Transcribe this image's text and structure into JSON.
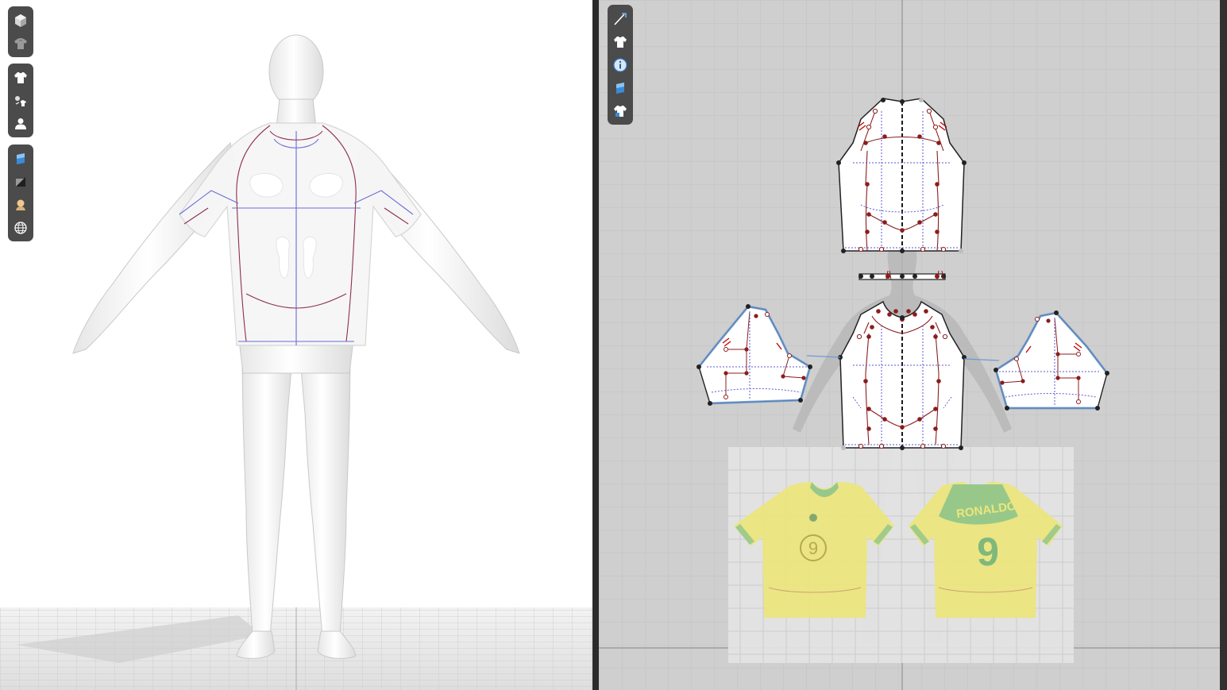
{
  "app": {
    "panes": [
      "3d-garment-window",
      "2d-pattern-window"
    ]
  },
  "toolbar_3d_groups": [
    {
      "items": [
        "cube-icon",
        "hanger-shirt-icon"
      ]
    },
    {
      "items": [
        "shirt-icon",
        "fabric-swap-icon",
        "avatar-icon"
      ]
    },
    {
      "items": [
        "texture-icon",
        "shading-icon",
        "light-icon",
        "globe-icon"
      ]
    }
  ],
  "toolbar_2d_items": [
    "pattern-edit-icon",
    "shirt-icon",
    "info-icon",
    "texture-icon",
    "shirt-lock-icon"
  ],
  "reference_sheet": {
    "back_name": "RONALDO",
    "front_number": "9",
    "back_number": "9"
  },
  "colors": {
    "panel_bg": "#cfcfcf",
    "toolbar_bg": "#4b4b4b",
    "pattern_outline": "#222222",
    "internal_line": "#8b1d1d",
    "seam_blue": "#5f94d3",
    "jersey_yellow": "#ece67a",
    "jersey_green": "#8fc48a"
  }
}
